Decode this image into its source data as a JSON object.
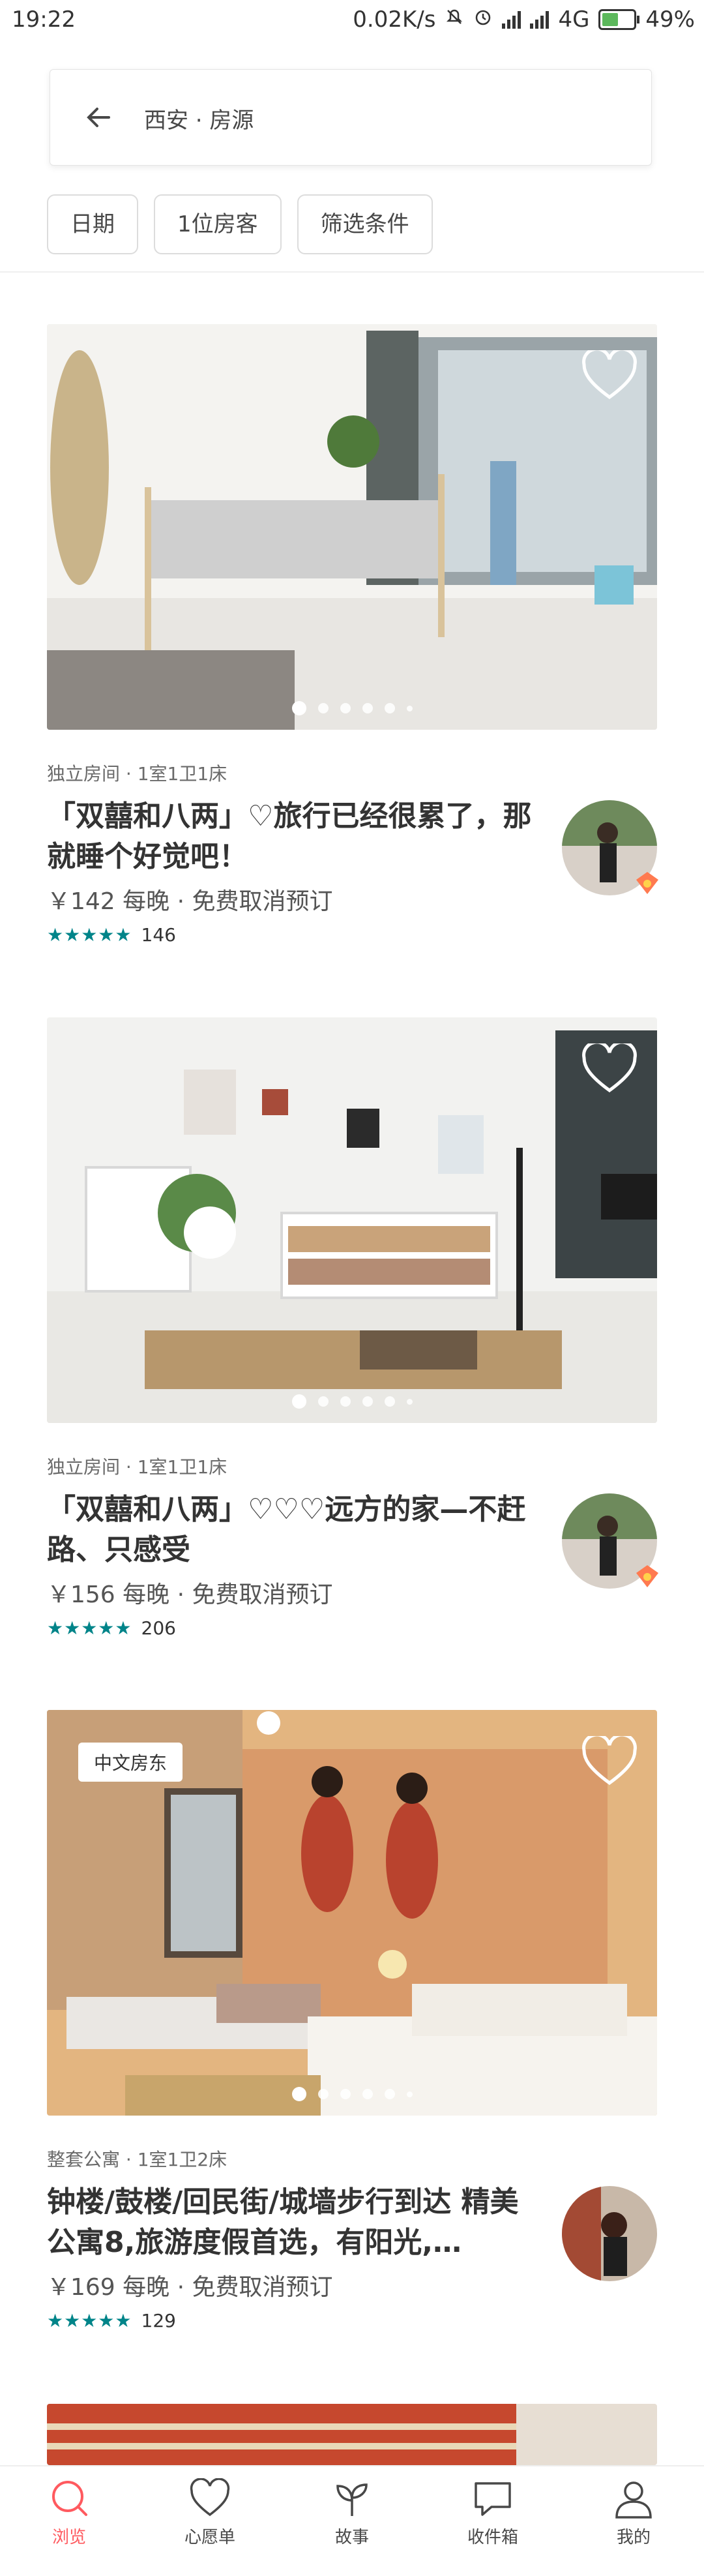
{
  "status_bar": {
    "time": "19:22",
    "network_speed": "0.02K/s",
    "network_type": "4G",
    "battery": "49%"
  },
  "search": {
    "query": "西安 · 房源"
  },
  "filters": [
    "日期",
    "1位房客",
    "筛选条件"
  ],
  "listings": [
    {
      "meta": "独立房间 · 1室1卫1床",
      "title": "「双囍和八两」♡旅行已经很累了，那就睡个好觉吧！",
      "price": "￥142 每晚 · 免费取消预订",
      "stars": "★★★★★",
      "reviews": "146",
      "badge": ""
    },
    {
      "meta": "独立房间 · 1室1卫1床",
      "title": "「双囍和八两」♡♡♡远方的家—不赶路、只感受",
      "price": "￥156 每晚 · 免费取消预订",
      "stars": "★★★★★",
      "reviews": "206",
      "badge": ""
    },
    {
      "meta": "整套公寓 · 1室1卫2床",
      "title": "钟楼/鼓楼/回民街/城墙步行到达 精美公寓8,旅游度假首选，有阳光,…",
      "price": "￥169 每晚 · 免费取消预订",
      "stars": "★★★★★",
      "reviews": "129",
      "badge": "中文房东"
    }
  ],
  "tabs": [
    {
      "label": "浏览",
      "icon": "search-icon",
      "active": true
    },
    {
      "label": "心愿单",
      "icon": "heart-icon",
      "active": false
    },
    {
      "label": "故事",
      "icon": "leaf-icon",
      "active": false
    },
    {
      "label": "收件箱",
      "icon": "message-icon",
      "active": false
    },
    {
      "label": "我的",
      "icon": "person-icon",
      "active": false
    }
  ],
  "colors": {
    "accent": "#ff5a5f",
    "rating": "#008489"
  }
}
